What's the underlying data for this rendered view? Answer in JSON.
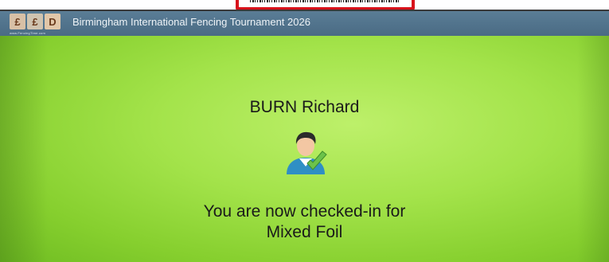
{
  "header": {
    "title": "Birmingham International Fencing Tournament 2026",
    "logo_caption": "www.FencingTime.com",
    "logo_glyphs": [
      "£",
      "£",
      "D"
    ]
  },
  "checkin": {
    "fencer_name": "BURN Richard",
    "message_line1": "You are now checked-in for",
    "message_line2": "Mixed Foil"
  },
  "icons": {
    "avatar": "user-checked-icon",
    "barcode": "barcode-icon"
  },
  "colors": {
    "screen_green": "#a3e34a",
    "header_blue": "#4a6b84",
    "check_green": "#6cc24a",
    "barcode_frame_red": "#d8121b"
  }
}
